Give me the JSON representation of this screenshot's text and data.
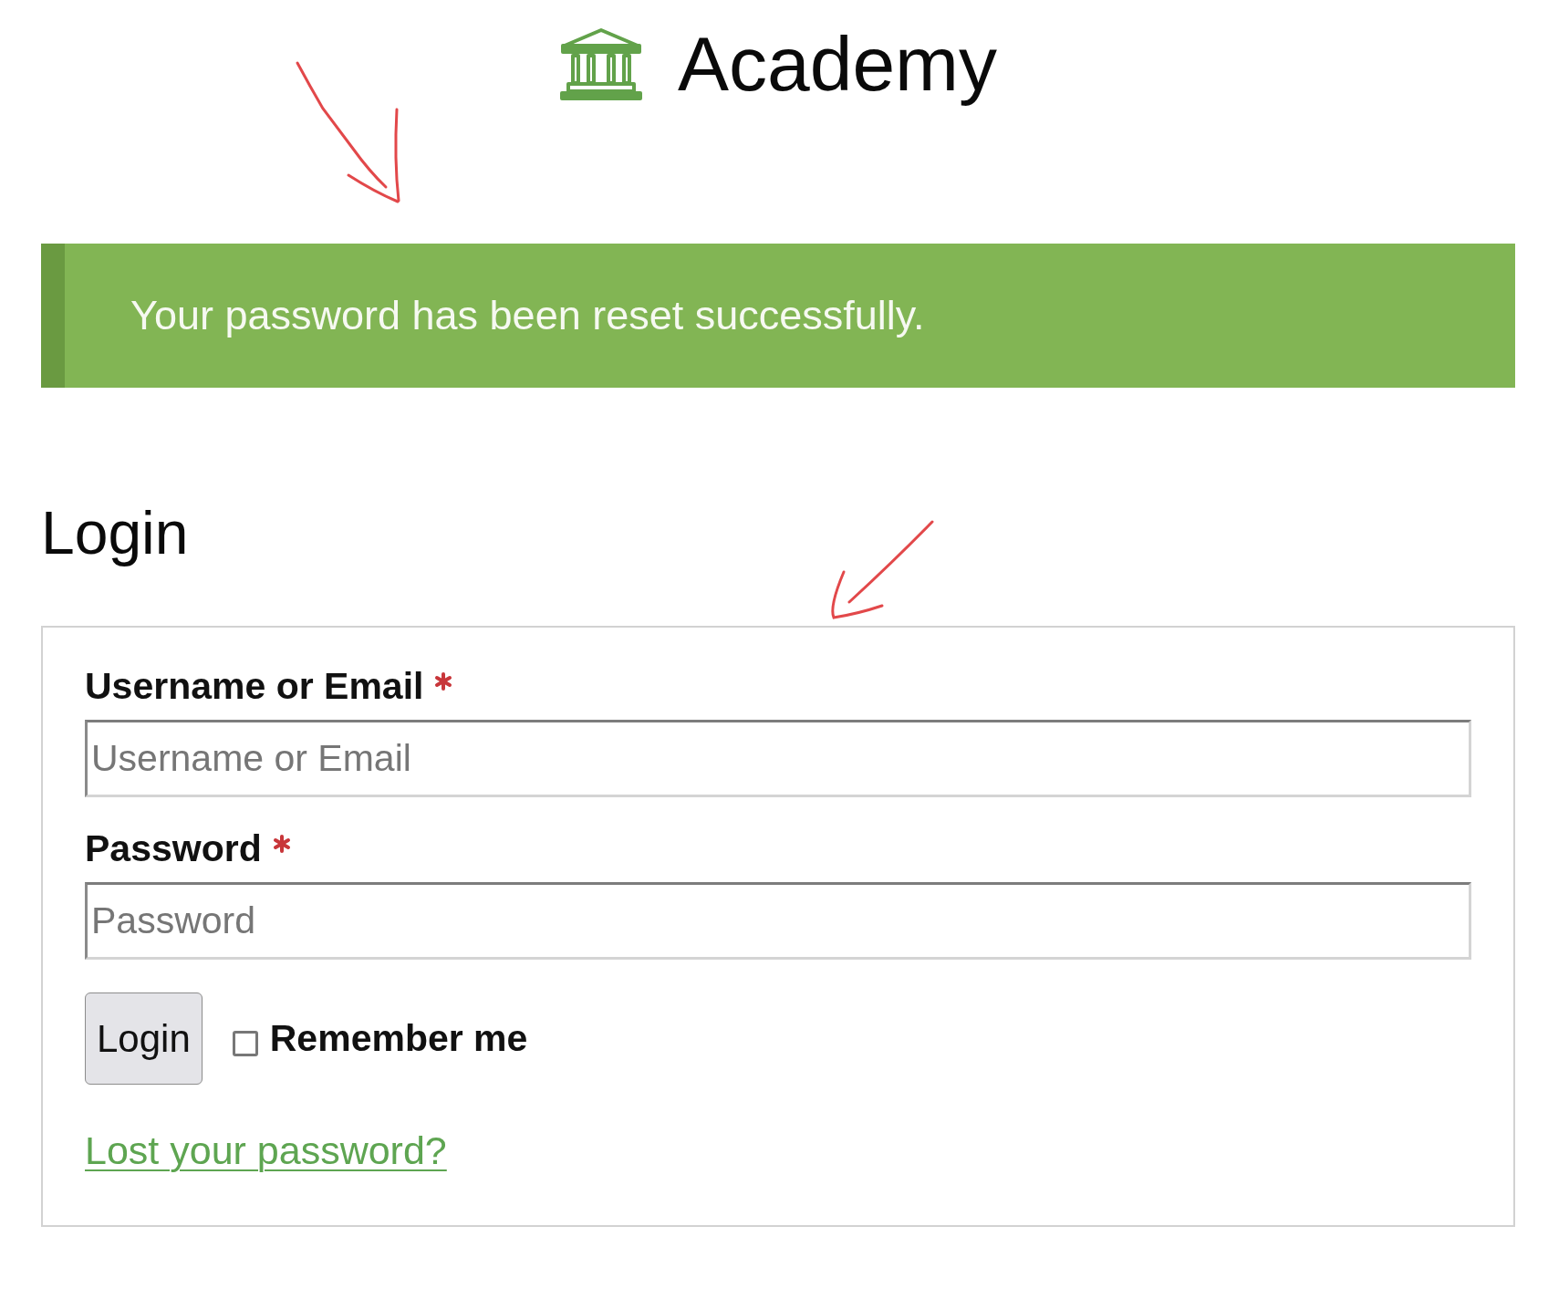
{
  "header": {
    "title": "Academy"
  },
  "alert": {
    "kind": "success",
    "message": "Your password has been reset successfully."
  },
  "heading": "Login",
  "form": {
    "fields": [
      {
        "label": "Username or Email",
        "required": true,
        "placeholder": "Username or Email"
      },
      {
        "label": "Password",
        "required": true,
        "placeholder": "Password"
      }
    ],
    "submit": "Login",
    "remember": {
      "label": "Remember me",
      "checked": false
    },
    "lost_password_link": "Lost your password?"
  }
}
